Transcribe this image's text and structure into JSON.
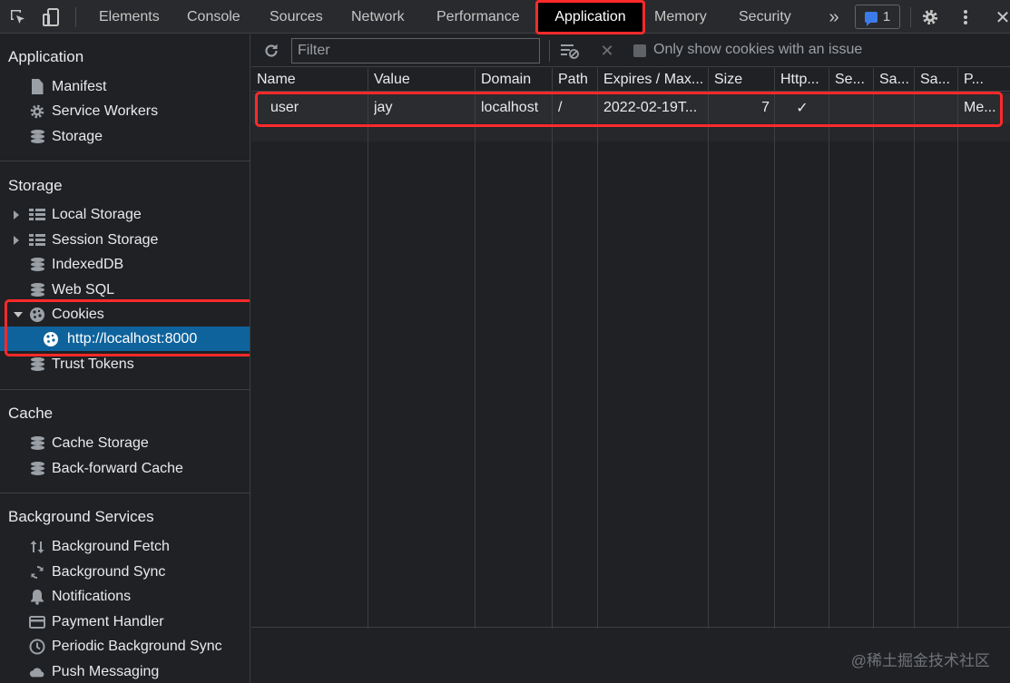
{
  "tabs": [
    {
      "label": "Elements"
    },
    {
      "label": "Console"
    },
    {
      "label": "Sources"
    },
    {
      "label": "Network"
    },
    {
      "label": "Performance"
    },
    {
      "label": "Application"
    },
    {
      "label": "Memory"
    },
    {
      "label": "Security"
    }
  ],
  "issues_count": "1",
  "sidebar": {
    "application": {
      "title": "Application",
      "items": [
        "Manifest",
        "Service Workers",
        "Storage"
      ]
    },
    "storage": {
      "title": "Storage",
      "items": [
        "Local Storage",
        "Session Storage",
        "IndexedDB",
        "Web SQL",
        "Cookies",
        "http://localhost:8000",
        "Trust Tokens"
      ]
    },
    "cache": {
      "title": "Cache",
      "items": [
        "Cache Storage",
        "Back-forward Cache"
      ]
    },
    "background": {
      "title": "Background Services",
      "items": [
        "Background Fetch",
        "Background Sync",
        "Notifications",
        "Payment Handler",
        "Periodic Background Sync",
        "Push Messaging"
      ]
    }
  },
  "toolbar": {
    "filter_placeholder": "Filter",
    "only_issue_label": "Only show cookies with an issue"
  },
  "table": {
    "headers": [
      "Name",
      "Value",
      "Domain",
      "Path",
      "Expires / Max...",
      "Size",
      "Http...",
      "Se...",
      "Sa...",
      "Sa...",
      "P..."
    ],
    "rows": [
      [
        "user",
        "jay",
        "localhost",
        "/",
        "2022-02-19T...",
        "7",
        "✓",
        "",
        "",
        "",
        "Me..."
      ]
    ]
  },
  "watermark": "@稀土掘金技术社区",
  "colors": {
    "accent": "#8ab4f8",
    "selected": "#0e639c",
    "highlight": "#ff2a2a"
  }
}
